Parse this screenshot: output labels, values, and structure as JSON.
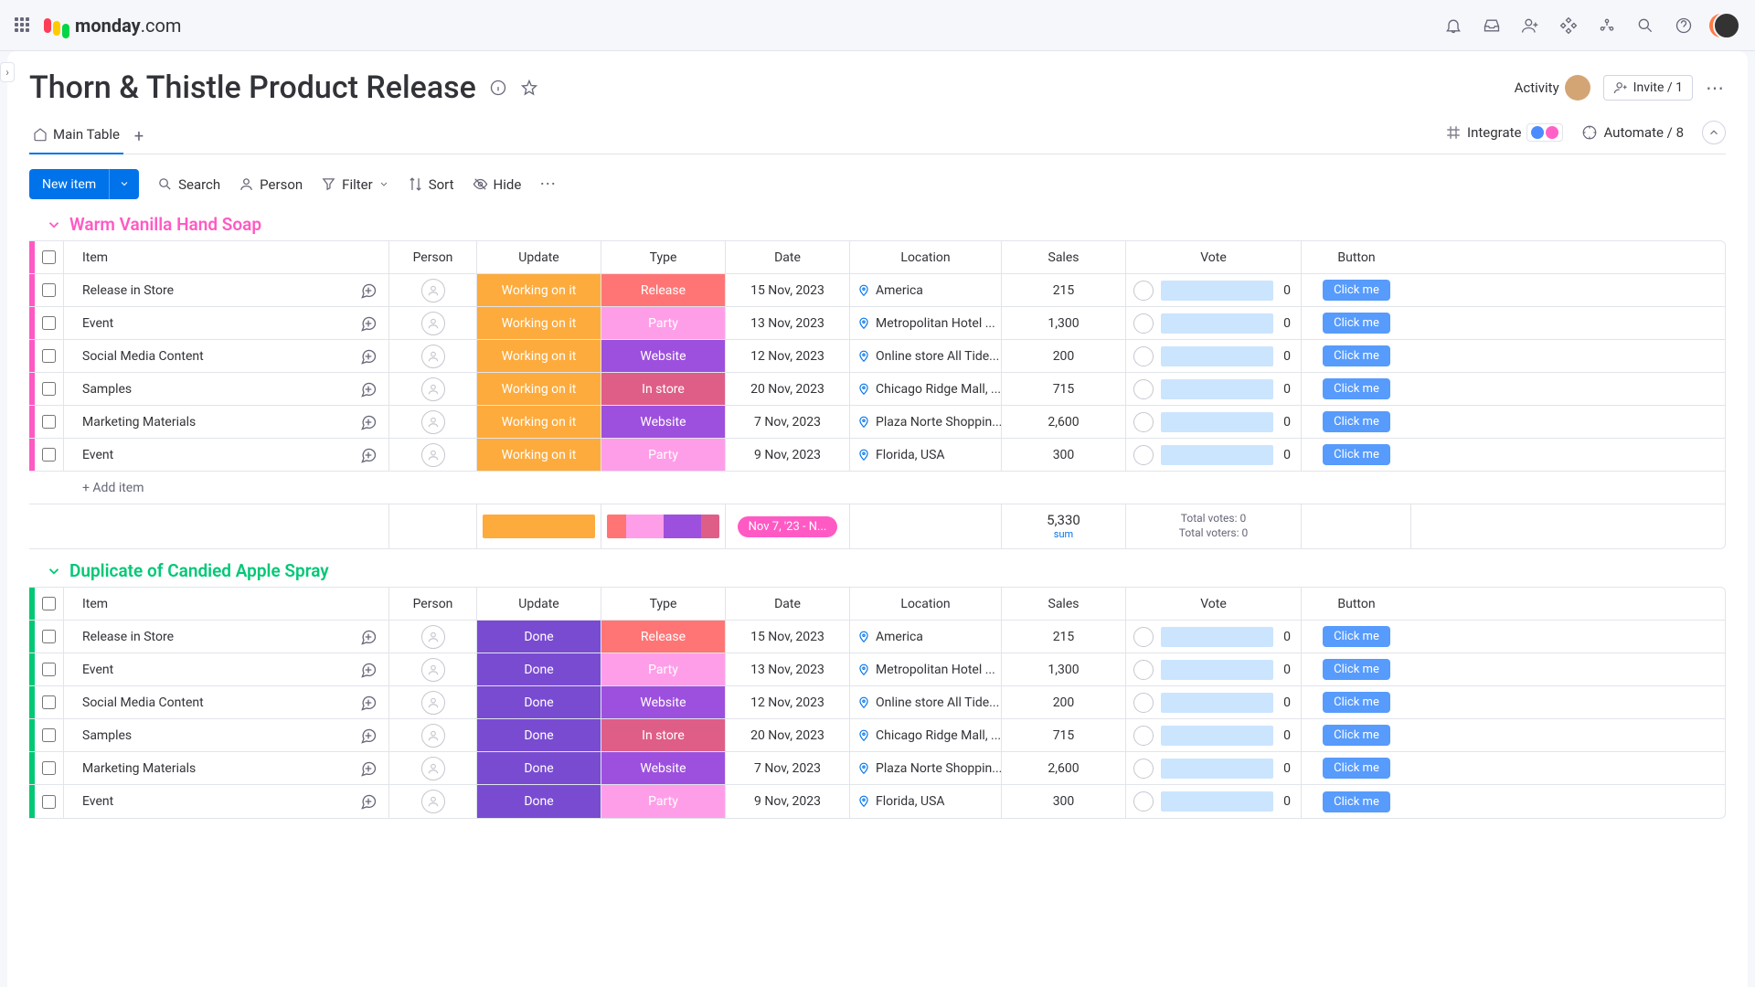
{
  "brand": "monday",
  "brand_suffix": ".com",
  "board": {
    "title": "Thorn & Thistle Product Release",
    "activity_label": "Activity",
    "invite_label": "Invite / 1",
    "main_tab": "Main Table",
    "integrate_label": "Integrate",
    "automate_label": "Automate / 8"
  },
  "toolbar": {
    "new_item": "New item",
    "search": "Search",
    "person": "Person",
    "filter": "Filter",
    "sort": "Sort",
    "hide": "Hide"
  },
  "columns": {
    "item": "Item",
    "person": "Person",
    "update": "Update",
    "type": "Type",
    "date": "Date",
    "location": "Location",
    "sales": "Sales",
    "vote": "Vote",
    "button": "Button"
  },
  "button_label": "Click me",
  "add_item": "+ Add item",
  "groups": [
    {
      "name": "Warm Vanilla Hand Soap",
      "color": "#ff5ac4",
      "items": [
        {
          "item": "Release in Store",
          "update": "Working on it",
          "update_cls": "st-working",
          "type": "Release",
          "type_cls": "ty-release",
          "date": "15 Nov, 2023",
          "location": "America",
          "sales": "215",
          "vote": "0"
        },
        {
          "item": "Event",
          "update": "Working on it",
          "update_cls": "st-working",
          "type": "Party",
          "type_cls": "ty-party",
          "date": "13 Nov, 2023",
          "location": "Metropolitan Hotel ...",
          "sales": "1,300",
          "vote": "0"
        },
        {
          "item": "Social Media Content",
          "update": "Working on it",
          "update_cls": "st-working",
          "type": "Website",
          "type_cls": "ty-website",
          "date": "12 Nov, 2023",
          "location": "Online store All Tide...",
          "sales": "200",
          "vote": "0"
        },
        {
          "item": "Samples",
          "update": "Working on it",
          "update_cls": "st-working",
          "type": "In store",
          "type_cls": "ty-instore",
          "date": "20 Nov, 2023",
          "location": "Chicago Ridge Mall, ...",
          "sales": "715",
          "vote": "0"
        },
        {
          "item": "Marketing Materials",
          "update": "Working on it",
          "update_cls": "st-working",
          "type": "Website",
          "type_cls": "ty-website",
          "date": "7 Nov, 2023",
          "location": "Plaza Norte Shoppin...",
          "sales": "2,600",
          "vote": "0"
        },
        {
          "item": "Event",
          "update": "Working on it",
          "update_cls": "st-working",
          "type": "Party",
          "type_cls": "ty-party",
          "date": "9 Nov, 2023",
          "location": "Florida, USA",
          "sales": "300",
          "vote": "0"
        }
      ],
      "summary": {
        "date_range": "Nov 7, '23 - N...",
        "sales_total": "5,330",
        "sales_label": "sum",
        "votes_line1": "Total votes: 0",
        "votes_line2": "Total voters: 0"
      }
    },
    {
      "name": "Duplicate of Candied Apple Spray",
      "color": "#00c875",
      "items": [
        {
          "item": "Release in Store",
          "update": "Done",
          "update_cls": "st-done",
          "type": "Release",
          "type_cls": "ty-release",
          "date": "15 Nov, 2023",
          "location": "America",
          "sales": "215",
          "vote": "0"
        },
        {
          "item": "Event",
          "update": "Done",
          "update_cls": "st-done",
          "type": "Party",
          "type_cls": "ty-party",
          "date": "13 Nov, 2023",
          "location": "Metropolitan Hotel ...",
          "sales": "1,300",
          "vote": "0"
        },
        {
          "item": "Social Media Content",
          "update": "Done",
          "update_cls": "st-done",
          "type": "Website",
          "type_cls": "ty-website",
          "date": "12 Nov, 2023",
          "location": "Online store All Tide...",
          "sales": "200",
          "vote": "0"
        },
        {
          "item": "Samples",
          "update": "Done",
          "update_cls": "st-done",
          "type": "In store",
          "type_cls": "ty-instore",
          "date": "20 Nov, 2023",
          "location": "Chicago Ridge Mall, ...",
          "sales": "715",
          "vote": "0"
        },
        {
          "item": "Marketing Materials",
          "update": "Done",
          "update_cls": "st-done",
          "type": "Website",
          "type_cls": "ty-website",
          "date": "7 Nov, 2023",
          "location": "Plaza Norte Shoppin...",
          "sales": "2,600",
          "vote": "0"
        },
        {
          "item": "Event",
          "update": "Done",
          "update_cls": "st-done",
          "type": "Party",
          "type_cls": "ty-party",
          "date": "9 Nov, 2023",
          "location": "Florida, USA",
          "sales": "300",
          "vote": "0"
        }
      ]
    }
  ]
}
